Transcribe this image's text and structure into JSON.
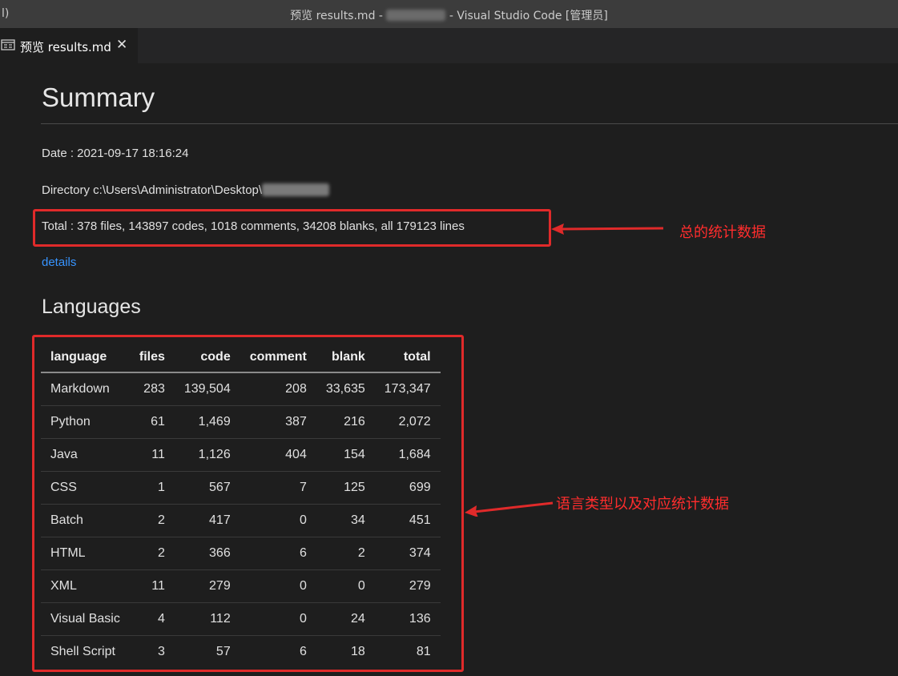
{
  "titlebar": {
    "left_glyph": "l)",
    "title_prefix": "预览 results.md - ",
    "title_suffix": " - Visual Studio Code [管理员]"
  },
  "tab": {
    "label": "预览 results.md",
    "close_glyph": "✕"
  },
  "doc": {
    "summary_heading": "Summary",
    "date_line": "Date : 2021-09-17 18:16:24",
    "directory_line": "Directory c:\\Users\\Administrator\\Desktop\\",
    "total_line": "Total : 378 files, 143897 codes, 1018 comments, 34208 blanks, all 179123 lines",
    "details_link": "details",
    "languages_heading": "Languages"
  },
  "annotations": {
    "total_note": "总的统计数据",
    "table_note": "语言类型以及对应统计数据",
    "color": "#e02a2a"
  },
  "table": {
    "headers": [
      "language",
      "files",
      "code",
      "comment",
      "blank",
      "total"
    ],
    "rows": [
      [
        "Markdown",
        "283",
        "139,504",
        "208",
        "33,635",
        "173,347"
      ],
      [
        "Python",
        "61",
        "1,469",
        "387",
        "216",
        "2,072"
      ],
      [
        "Java",
        "11",
        "1,126",
        "404",
        "154",
        "1,684"
      ],
      [
        "CSS",
        "1",
        "567",
        "7",
        "125",
        "699"
      ],
      [
        "Batch",
        "2",
        "417",
        "0",
        "34",
        "451"
      ],
      [
        "HTML",
        "2",
        "366",
        "6",
        "2",
        "374"
      ],
      [
        "XML",
        "11",
        "279",
        "0",
        "0",
        "279"
      ],
      [
        "Visual Basic",
        "4",
        "112",
        "0",
        "24",
        "136"
      ],
      [
        "Shell Script",
        "3",
        "57",
        "6",
        "18",
        "81"
      ]
    ]
  },
  "colors": {
    "background": "#1e1e1e",
    "titlebar": "#3c3c3c",
    "link": "#3794ff"
  }
}
